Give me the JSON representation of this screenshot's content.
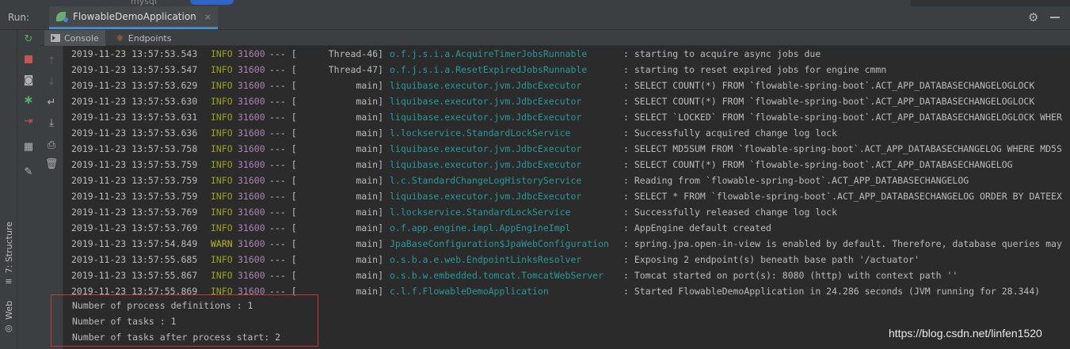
{
  "top_strip": {
    "tab_remnant": "mysql"
  },
  "run_header": {
    "label": "Run:",
    "tab_label": "FlowableDemoApplication",
    "close_glyph": "×"
  },
  "console_tabs": [
    {
      "label": "Console",
      "active": true
    },
    {
      "label": "Endpoints",
      "active": false
    }
  ],
  "side_tabs": {
    "structure": "7: Structure",
    "web": "Web"
  },
  "log_lines": [
    {
      "ts": "2019-11-23 13:57:53.543",
      "level": "INFO",
      "pid": "31600",
      "sep": "--- [",
      "thread": "Thread-46]",
      "logger": "o.f.j.s.i.a.AcquireTimerJobsRunnable",
      "msg": ": starting to acquire async jobs due"
    },
    {
      "ts": "2019-11-23 13:57:53.547",
      "level": "INFO",
      "pid": "31600",
      "sep": "--- [",
      "thread": "Thread-47]",
      "logger": "o.f.j.s.i.a.ResetExpiredJobsRunnable",
      "msg": ": starting to reset expired jobs for engine cmmn"
    },
    {
      "ts": "2019-11-23 13:57:53.629",
      "level": "INFO",
      "pid": "31600",
      "sep": "--- [",
      "thread": "main]",
      "logger": "liquibase.executor.jvm.JdbcExecutor",
      "msg": ": SELECT COUNT(*) FROM `flowable-spring-boot`.ACT_APP_DATABASECHANGELOGLOCK"
    },
    {
      "ts": "2019-11-23 13:57:53.630",
      "level": "INFO",
      "pid": "31600",
      "sep": "--- [",
      "thread": "main]",
      "logger": "liquibase.executor.jvm.JdbcExecutor",
      "msg": ": SELECT COUNT(*) FROM `flowable-spring-boot`.ACT_APP_DATABASECHANGELOGLOCK"
    },
    {
      "ts": "2019-11-23 13:57:53.631",
      "level": "INFO",
      "pid": "31600",
      "sep": "--- [",
      "thread": "main]",
      "logger": "liquibase.executor.jvm.JdbcExecutor",
      "msg": ": SELECT `LOCKED` FROM `flowable-spring-boot`.ACT_APP_DATABASECHANGELOGLOCK WHER"
    },
    {
      "ts": "2019-11-23 13:57:53.636",
      "level": "INFO",
      "pid": "31600",
      "sep": "--- [",
      "thread": "main]",
      "logger": "l.lockservice.StandardLockService",
      "msg": ": Successfully acquired change log lock"
    },
    {
      "ts": "2019-11-23 13:57:53.758",
      "level": "INFO",
      "pid": "31600",
      "sep": "--- [",
      "thread": "main]",
      "logger": "liquibase.executor.jvm.JdbcExecutor",
      "msg": ": SELECT MD5SUM FROM `flowable-spring-boot`.ACT_APP_DATABASECHANGELOG WHERE MD5S"
    },
    {
      "ts": "2019-11-23 13:57:53.759",
      "level": "INFO",
      "pid": "31600",
      "sep": "--- [",
      "thread": "main]",
      "logger": "liquibase.executor.jvm.JdbcExecutor",
      "msg": ": SELECT COUNT(*) FROM `flowable-spring-boot`.ACT_APP_DATABASECHANGELOG"
    },
    {
      "ts": "2019-11-23 13:57:53.759",
      "level": "INFO",
      "pid": "31600",
      "sep": "--- [",
      "thread": "main]",
      "logger": "l.c.StandardChangeLogHistoryService",
      "msg": ": Reading from `flowable-spring-boot`.ACT_APP_DATABASECHANGELOG"
    },
    {
      "ts": "2019-11-23 13:57:53.759",
      "level": "INFO",
      "pid": "31600",
      "sep": "--- [",
      "thread": "main]",
      "logger": "liquibase.executor.jvm.JdbcExecutor",
      "msg": ": SELECT * FROM `flowable-spring-boot`.ACT_APP_DATABASECHANGELOG ORDER BY DATEEX"
    },
    {
      "ts": "2019-11-23 13:57:53.769",
      "level": "INFO",
      "pid": "31600",
      "sep": "--- [",
      "thread": "main]",
      "logger": "l.lockservice.StandardLockService",
      "msg": ": Successfully released change log lock"
    },
    {
      "ts": "2019-11-23 13:57:53.769",
      "level": "INFO",
      "pid": "31600",
      "sep": "--- [",
      "thread": "main]",
      "logger": "o.f.app.engine.impl.AppEngineImpl",
      "msg": ": AppEngine default created"
    },
    {
      "ts": "2019-11-23 13:57:54.849",
      "level": "WARN",
      "pid": "31600",
      "sep": "--- [",
      "thread": "main]",
      "logger": "JpaBaseConfiguration$JpaWebConfiguration",
      "msg": ": spring.jpa.open-in-view is enabled by default. Therefore, database queries may"
    },
    {
      "ts": "2019-11-23 13:57:55.685",
      "level": "INFO",
      "pid": "31600",
      "sep": "--- [",
      "thread": "main]",
      "logger": "o.s.b.a.e.web.EndpointLinksResolver",
      "msg": ": Exposing 2 endpoint(s) beneath base path '/actuator'"
    },
    {
      "ts": "2019-11-23 13:57:55.867",
      "level": "INFO",
      "pid": "31600",
      "sep": "--- [",
      "thread": "main]",
      "logger": "o.s.b.w.embedded.tomcat.TomcatWebServer",
      "msg": ": Tomcat started on port(s): 8080 (http) with context path ''"
    },
    {
      "ts": "2019-11-23 13:57:55.869",
      "level": "INFO",
      "pid": "31600",
      "sep": "--- [",
      "thread": "main]",
      "logger": "c.l.f.FlowableDemoApplication",
      "msg": ": Started FlowableDemoApplication in 24.286 seconds (JVM running for 28.344)"
    }
  ],
  "output_lines": [
    "Number of process definitions : 1",
    "Number of tasks : 1",
    "Number of tasks after process start: 2"
  ],
  "watermark": "https://blog.csdn.net/linfen1520",
  "colors": {
    "background": "#2b2b2b",
    "panel": "#3c3f41",
    "info": "#9ba11d",
    "pid": "#ab83b3",
    "logger": "#299999",
    "highlight_box": "#c23b32",
    "tab_underline": "#4a88c7"
  }
}
